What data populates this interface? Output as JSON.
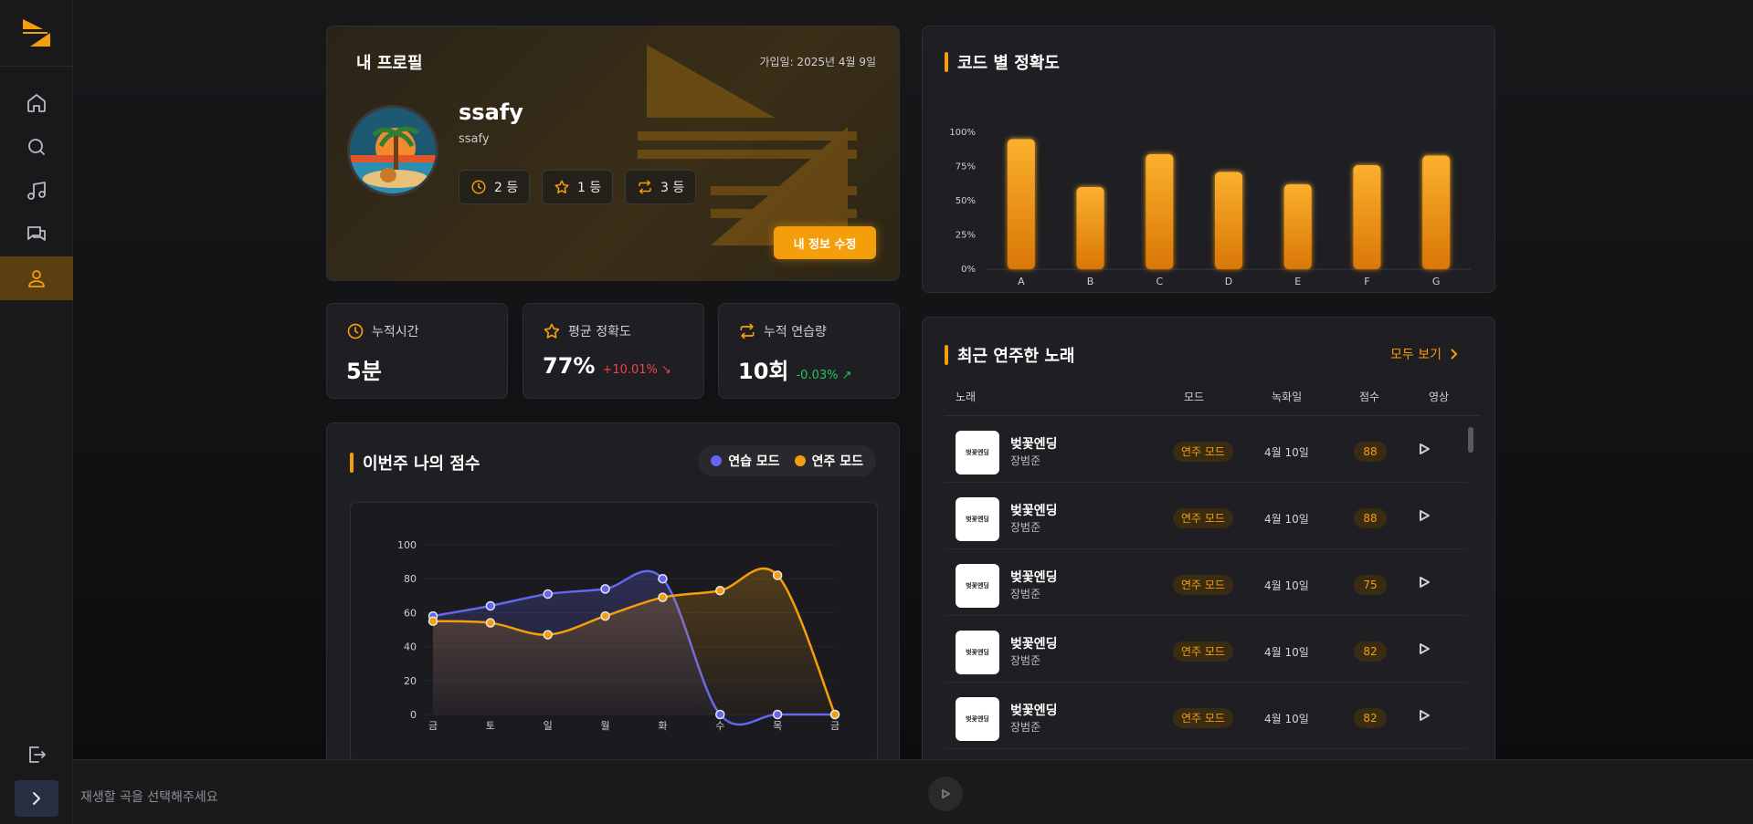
{
  "profile": {
    "heading": "내 프로필",
    "joined": "가입일: 2025년 4월 9일",
    "name": "ssafy",
    "id": "ssafy",
    "stats": [
      "2 등",
      "1 등",
      "3 등"
    ],
    "edit_label": "내 정보 수정"
  },
  "metrics": {
    "time": {
      "label": "누적시간",
      "value": "5분"
    },
    "accuracy": {
      "label": "평균 정확도",
      "value": "77%",
      "change": "+10.01% ↘"
    },
    "practice": {
      "label": "누적 연습량",
      "value": "10회",
      "change": "-0.03% ↗"
    }
  },
  "score": {
    "heading": "이번주 나의 점수",
    "legend": [
      "연습 모드",
      "연주 모드"
    ]
  },
  "accuracy_chart": {
    "heading": "코드 별 정확도"
  },
  "recent": {
    "heading": "최근 연주한 노래",
    "see_all": "모두 보기",
    "columns": [
      "노래",
      "모드",
      "녹화일",
      "점수",
      "영상"
    ],
    "rows": [
      {
        "title": "벚꽃엔딩",
        "artist": "장범준",
        "mode": "연주 모드",
        "date": "4월 10일",
        "score": "88"
      },
      {
        "title": "벚꽃엔딩",
        "artist": "장범준",
        "mode": "연주 모드",
        "date": "4월 10일",
        "score": "88"
      },
      {
        "title": "벚꽃엔딩",
        "artist": "장범준",
        "mode": "연주 모드",
        "date": "4월 10일",
        "score": "75"
      },
      {
        "title": "벚꽃엔딩",
        "artist": "장범준",
        "mode": "연주 모드",
        "date": "4월 10일",
        "score": "82"
      },
      {
        "title": "벚꽃엔딩",
        "artist": "장범준",
        "mode": "연주 모드",
        "date": "4월 10일",
        "score": "82"
      }
    ]
  },
  "player": {
    "placeholder": "재생할 곡을 선택해주세요"
  },
  "colors": {
    "accent": "#f59e0b",
    "practice": "#6366f1",
    "perform": "#f59e0b",
    "up": "#ef4444",
    "down": "#22c55e"
  },
  "icons": {
    "nav": [
      "home-icon",
      "search-icon",
      "music-icon",
      "chat-icon",
      "user-icon"
    ],
    "bottom": [
      "logout-icon",
      "chevron-right-icon"
    ]
  },
  "chart_data": [
    {
      "type": "bar",
      "categories": [
        "A",
        "B",
        "C",
        "D",
        "E",
        "F",
        "G"
      ],
      "values": [
        95,
        60,
        84,
        71,
        62,
        76,
        83
      ],
      "title": "코드 별 정확도",
      "ylim": [
        0,
        100
      ],
      "yticks": [
        "0%",
        "25%",
        "50%",
        "75%",
        "100%"
      ],
      "grid": false
    },
    {
      "type": "line",
      "categories": [
        "금",
        "토",
        "일",
        "월",
        "화",
        "수",
        "목",
        "금"
      ],
      "title": "이번주 나의 점수",
      "ylim": [
        0,
        100
      ],
      "yticks": [
        "0",
        "20",
        "40",
        "60",
        "80",
        "100"
      ],
      "legend": "top-right",
      "series": [
        {
          "name": "연습 모드",
          "color": "#6366f1",
          "values": [
            58,
            64,
            71,
            74,
            80,
            0,
            0,
            0
          ]
        },
        {
          "name": "연주 모드",
          "color": "#f59e0b",
          "values": [
            55,
            54,
            47,
            58,
            69,
            73,
            82,
            0
          ]
        }
      ]
    }
  ]
}
